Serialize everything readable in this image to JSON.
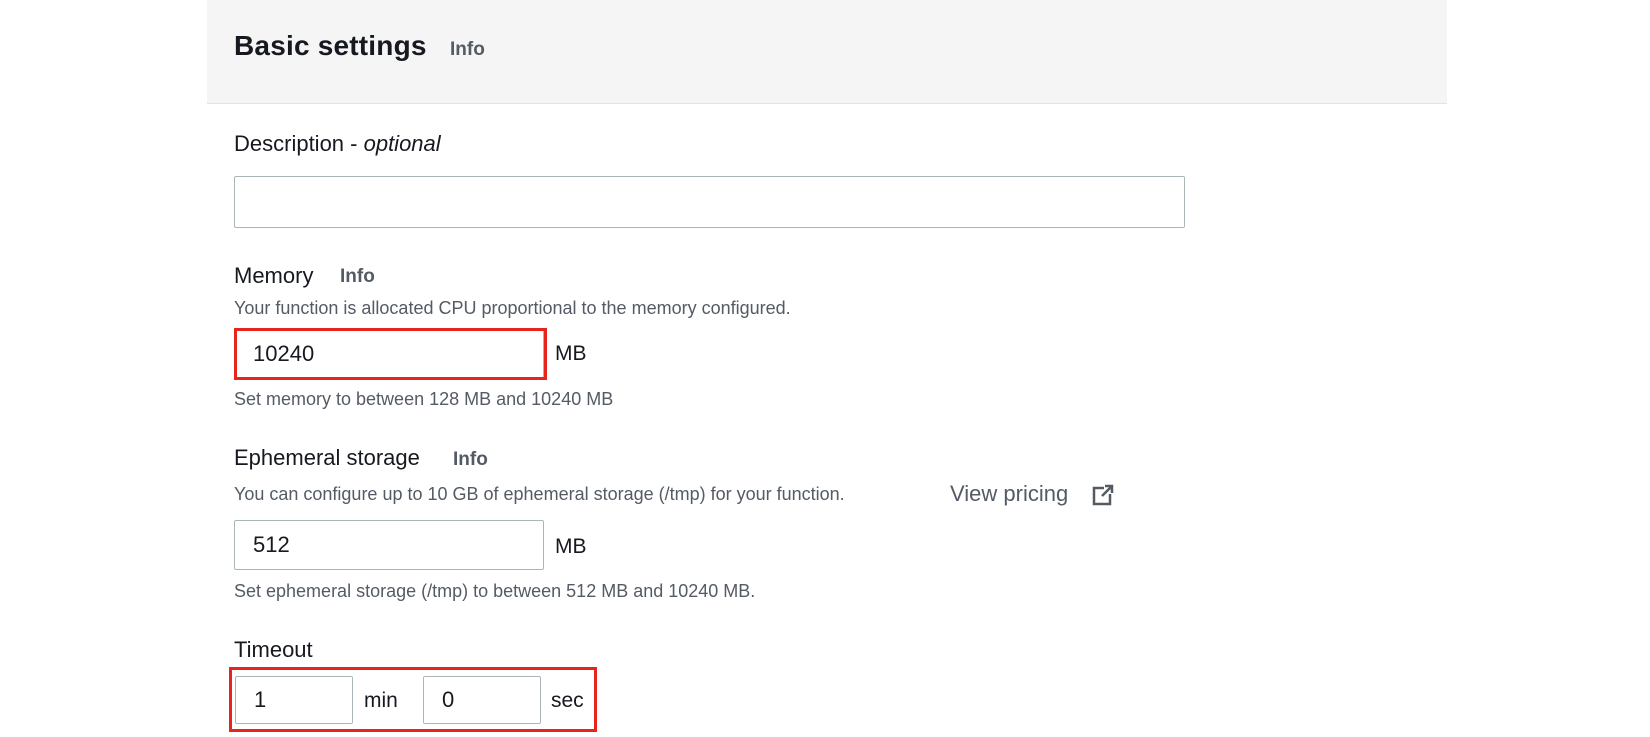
{
  "panel": {
    "title": "Basic settings",
    "info_label": "Info"
  },
  "description": {
    "label": "Description - ",
    "label_optional": "optional",
    "value": ""
  },
  "memory": {
    "label": "Memory",
    "info_label": "Info",
    "help_text": "Your function is allocated CPU proportional to the memory configured.",
    "value": "10240",
    "unit": "MB",
    "constraint": "Set memory to between 128 MB and 10240 MB",
    "highlighted": true,
    "highlight_color": "#e8241f"
  },
  "ephemeral_storage": {
    "label": "Ephemeral storage",
    "info_label": "Info",
    "help_text": "You can configure up to 10 GB of ephemeral storage (/tmp) for your function.",
    "link_label": "View pricing",
    "link_icon": "external-link-icon",
    "value": "512",
    "unit": "MB",
    "constraint": "Set ephemeral storage (/tmp) to between 512 MB and 10240 MB."
  },
  "timeout": {
    "label": "Timeout",
    "minutes_value": "1",
    "minutes_unit": "min",
    "seconds_value": "0",
    "seconds_unit": "sec",
    "highlighted": true,
    "highlight_color": "#e8241f"
  }
}
